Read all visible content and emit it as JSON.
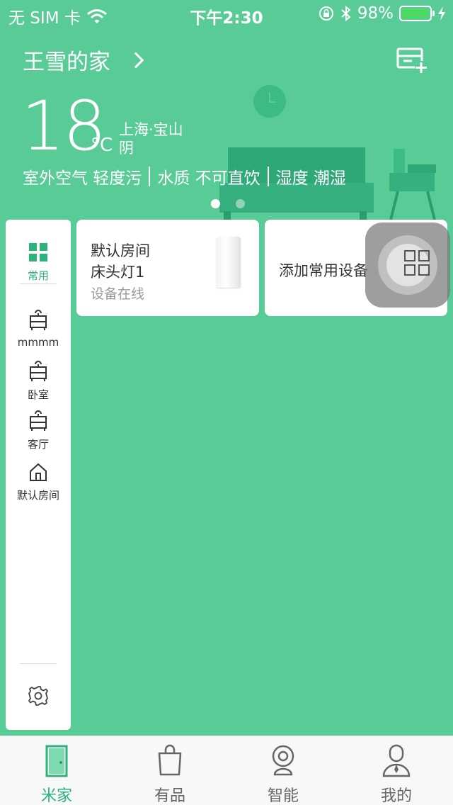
{
  "status_bar": {
    "carrier": "无 SIM 卡",
    "time": "下午2:30",
    "battery": "98%",
    "battery_level": 0.98
  },
  "header": {
    "home_name": "王雪的家"
  },
  "weather": {
    "temperature": "18",
    "unit": "°C",
    "location": "上海·宝山",
    "condition": "阴",
    "air": "室外空气 轻度污",
    "water": "水质 不可直饮",
    "humidity": "湿度 潮湿"
  },
  "pager": {
    "pages": 2,
    "active": 0
  },
  "sidebar": {
    "items": [
      {
        "label": "常用",
        "icon": "grid-icon"
      },
      {
        "label": "mmmm",
        "icon": "room-icon"
      },
      {
        "label": "卧室",
        "icon": "room-icon"
      },
      {
        "label": "客厅",
        "icon": "room-icon"
      },
      {
        "label": "默认房间",
        "icon": "house-icon"
      }
    ],
    "settings_icon": "gear-icon"
  },
  "cards": {
    "device": {
      "room": "默认房间",
      "name": "床头灯1",
      "status": "设备在线"
    },
    "add_label": "添加常用设备"
  },
  "tabs": [
    {
      "label": "米家",
      "icon": "door-icon"
    },
    {
      "label": "有品",
      "icon": "bag-icon"
    },
    {
      "label": "智能",
      "icon": "camera-icon"
    },
    {
      "label": "我的",
      "icon": "person-icon"
    }
  ],
  "colors": {
    "background": "#58cb96",
    "accent": "#2ab37b",
    "battery": "#4cd964"
  }
}
